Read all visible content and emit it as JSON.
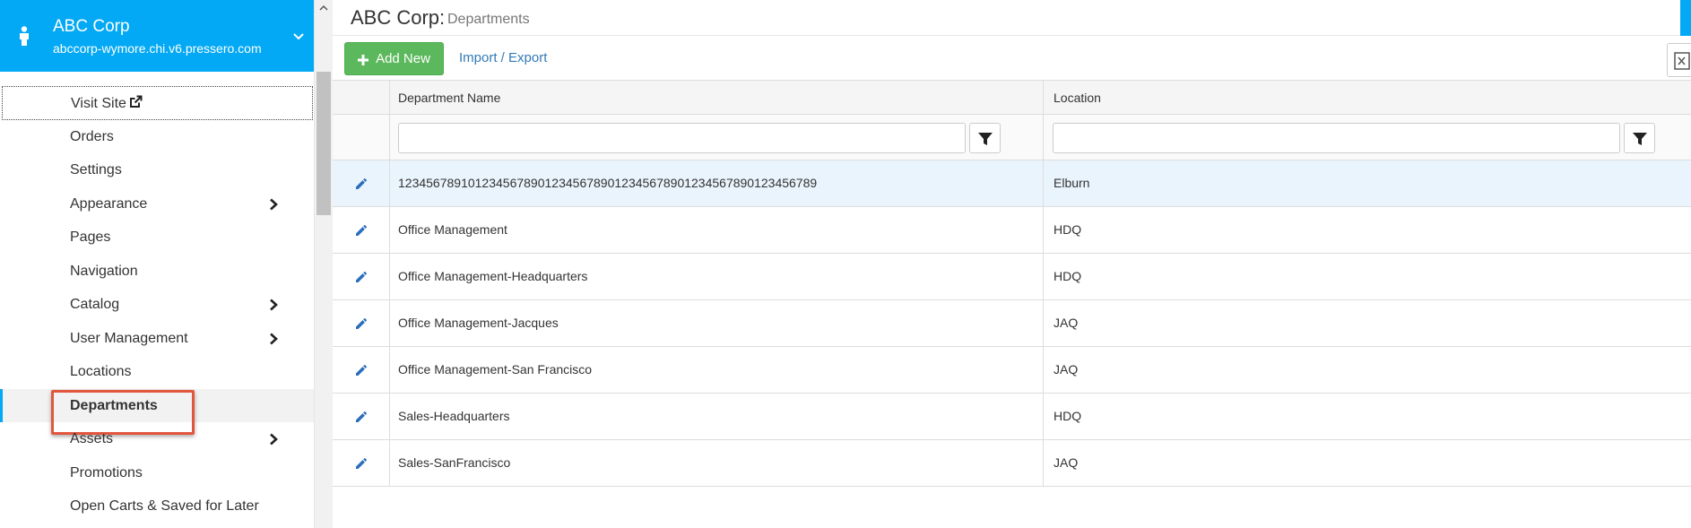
{
  "site": {
    "name": "ABC Corp",
    "domain": "abccorp-wymore.chi.v6.pressero.com"
  },
  "nav": {
    "visit_site": "Visit Site",
    "items": [
      {
        "label": "Orders",
        "submenu": false
      },
      {
        "label": "Settings",
        "submenu": false
      },
      {
        "label": "Appearance",
        "submenu": true
      },
      {
        "label": "Pages",
        "submenu": false
      },
      {
        "label": "Navigation",
        "submenu": false
      },
      {
        "label": "Catalog",
        "submenu": true
      },
      {
        "label": "User Management",
        "submenu": true
      },
      {
        "label": "Locations",
        "submenu": false
      },
      {
        "label": "Departments",
        "submenu": false,
        "active": true
      },
      {
        "label": "Assets",
        "submenu": true
      },
      {
        "label": "Promotions",
        "submenu": false
      },
      {
        "label": "Open Carts & Saved for Later",
        "submenu": false
      }
    ]
  },
  "page": {
    "title": "ABC Corp:",
    "subtitle": "Departments"
  },
  "toolbar": {
    "add_new": "Add New",
    "import_export": "Import / Export"
  },
  "grid": {
    "columns": [
      "Department Name",
      "Location"
    ],
    "rows": [
      {
        "name": "123456789101234567890123456789012345678901234567890123456789",
        "location": "Elburn",
        "selected": true
      },
      {
        "name": "Office Management",
        "location": "HDQ"
      },
      {
        "name": "Office Management-Headquarters",
        "location": "HDQ"
      },
      {
        "name": "Office Management-Jacques",
        "location": "JAQ"
      },
      {
        "name": "Office Management-San Francisco",
        "location": "JAQ"
      },
      {
        "name": "Sales-Headquarters",
        "location": "HDQ"
      },
      {
        "name": "Sales-SanFrancisco",
        "location": "JAQ"
      }
    ]
  },
  "colors": {
    "brand": "#03a9f4",
    "add_button": "#5cb85c",
    "link": "#337ab7",
    "highlight": "#e2563e"
  },
  "icons": {
    "site": "person-icon",
    "expand": "chevron-down-icon",
    "submenu": "chevron-right-icon",
    "external": "external-link-icon",
    "add": "plus-icon",
    "filter": "filter-icon",
    "edit": "pencil-icon",
    "export": "excel-icon"
  }
}
